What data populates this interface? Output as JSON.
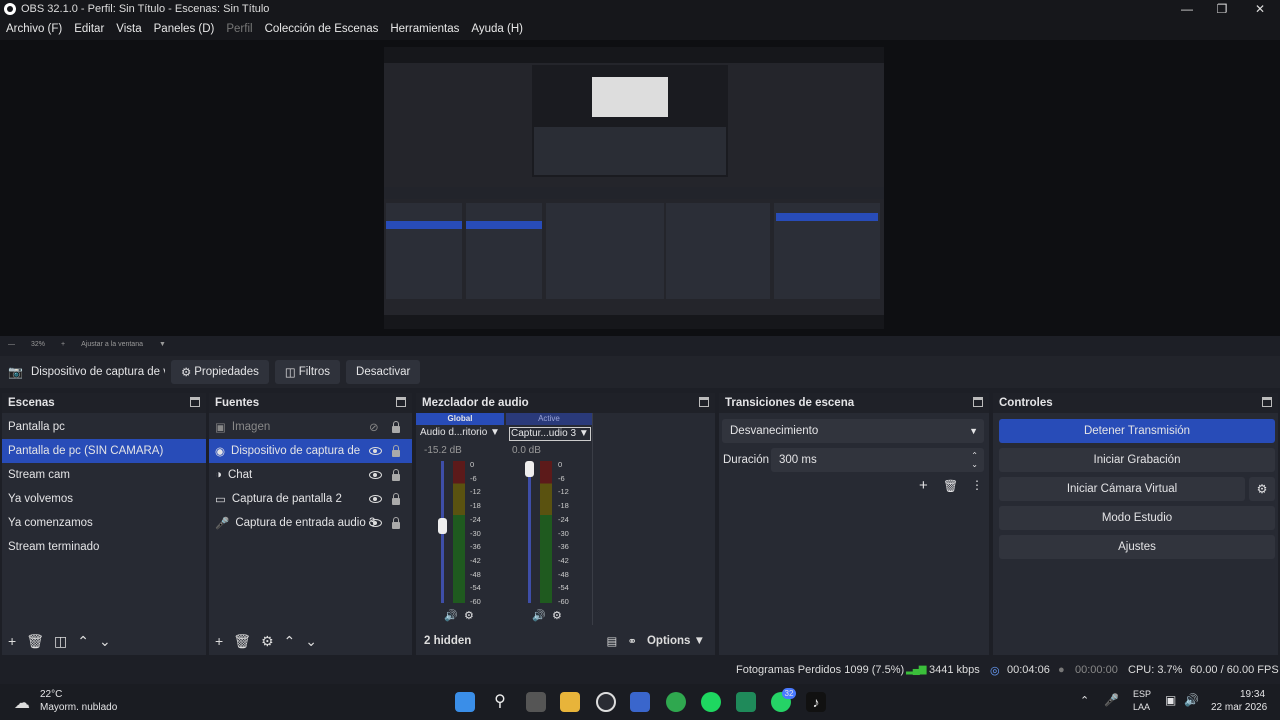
{
  "window": {
    "title": "OBS 32.1.0 - Perfil: Sin Título - Escenas: Sin Título"
  },
  "menu": [
    "Archivo (F)",
    "Editar",
    "Vista",
    "Paneles (D)",
    "Perfil",
    "Colección de Escenas",
    "Herramientas",
    "Ayuda (H)"
  ],
  "preview": {
    "zoom": "32%",
    "fit": "Ajustar a la ventana"
  },
  "source_toolbar": {
    "source": "Dispositivo de captura de v",
    "properties": "Propiedades",
    "filters": "Filtros",
    "deactivate": "Desactivar"
  },
  "scenes": {
    "title": "Escenas",
    "items": [
      "Pantalla pc",
      "Pantalla de pc (SIN CAMARA)",
      "Stream cam",
      "Ya volvemos",
      "Ya comenzamos",
      "Stream terminado"
    ],
    "selected": 1
  },
  "sources": {
    "title": "Fuentes",
    "items": [
      "Imagen",
      "Dispositivo de captura de v",
      "Chat",
      "Captura de pantalla 2",
      "Captura de entrada audio 3"
    ],
    "selected": 1
  },
  "mixer": {
    "title": "Mezclador de audio",
    "tab_global": "Global",
    "tab_active": "Active",
    "channels": [
      {
        "name": "Audio d...ritorio",
        "db": "-15.2 dB",
        "level": 0.55
      },
      {
        "name": "Captur...udio 3",
        "db": "0.0 dB",
        "level": 1.0
      }
    ],
    "ticks": [
      "0",
      "-6",
      "-12",
      "-18",
      "-24",
      "-30",
      "-36",
      "-42",
      "-48",
      "-54",
      "-60"
    ],
    "hidden": "2 hidden",
    "options": "Options"
  },
  "transitions": {
    "title": "Transiciones de escena",
    "selected": "Desvanecimiento",
    "duration_label": "Duración",
    "duration": "300 ms"
  },
  "controls": {
    "title": "Controles",
    "stop_stream": "Detener Transmisión",
    "start_record": "Iniciar Grabación",
    "virtual_cam": "Iniciar Cámara Virtual",
    "studio": "Modo Estudio",
    "settings": "Ajustes"
  },
  "status": {
    "dropped": "Fotogramas Perdidos 1099 (7.5%)",
    "kbps": "3441 kbps",
    "stream_time": "00:04:06",
    "rec_time": "00:00:00",
    "cpu": "CPU: 3.7%",
    "fps": "60.00 / 60.00 FPS"
  },
  "taskbar": {
    "temp": "22°C",
    "weather": "Mayorm. nublado",
    "lang1": "ESP",
    "lang2": "LAA",
    "time": "19:34",
    "date": "22 mar 2026",
    "badge": "32"
  }
}
